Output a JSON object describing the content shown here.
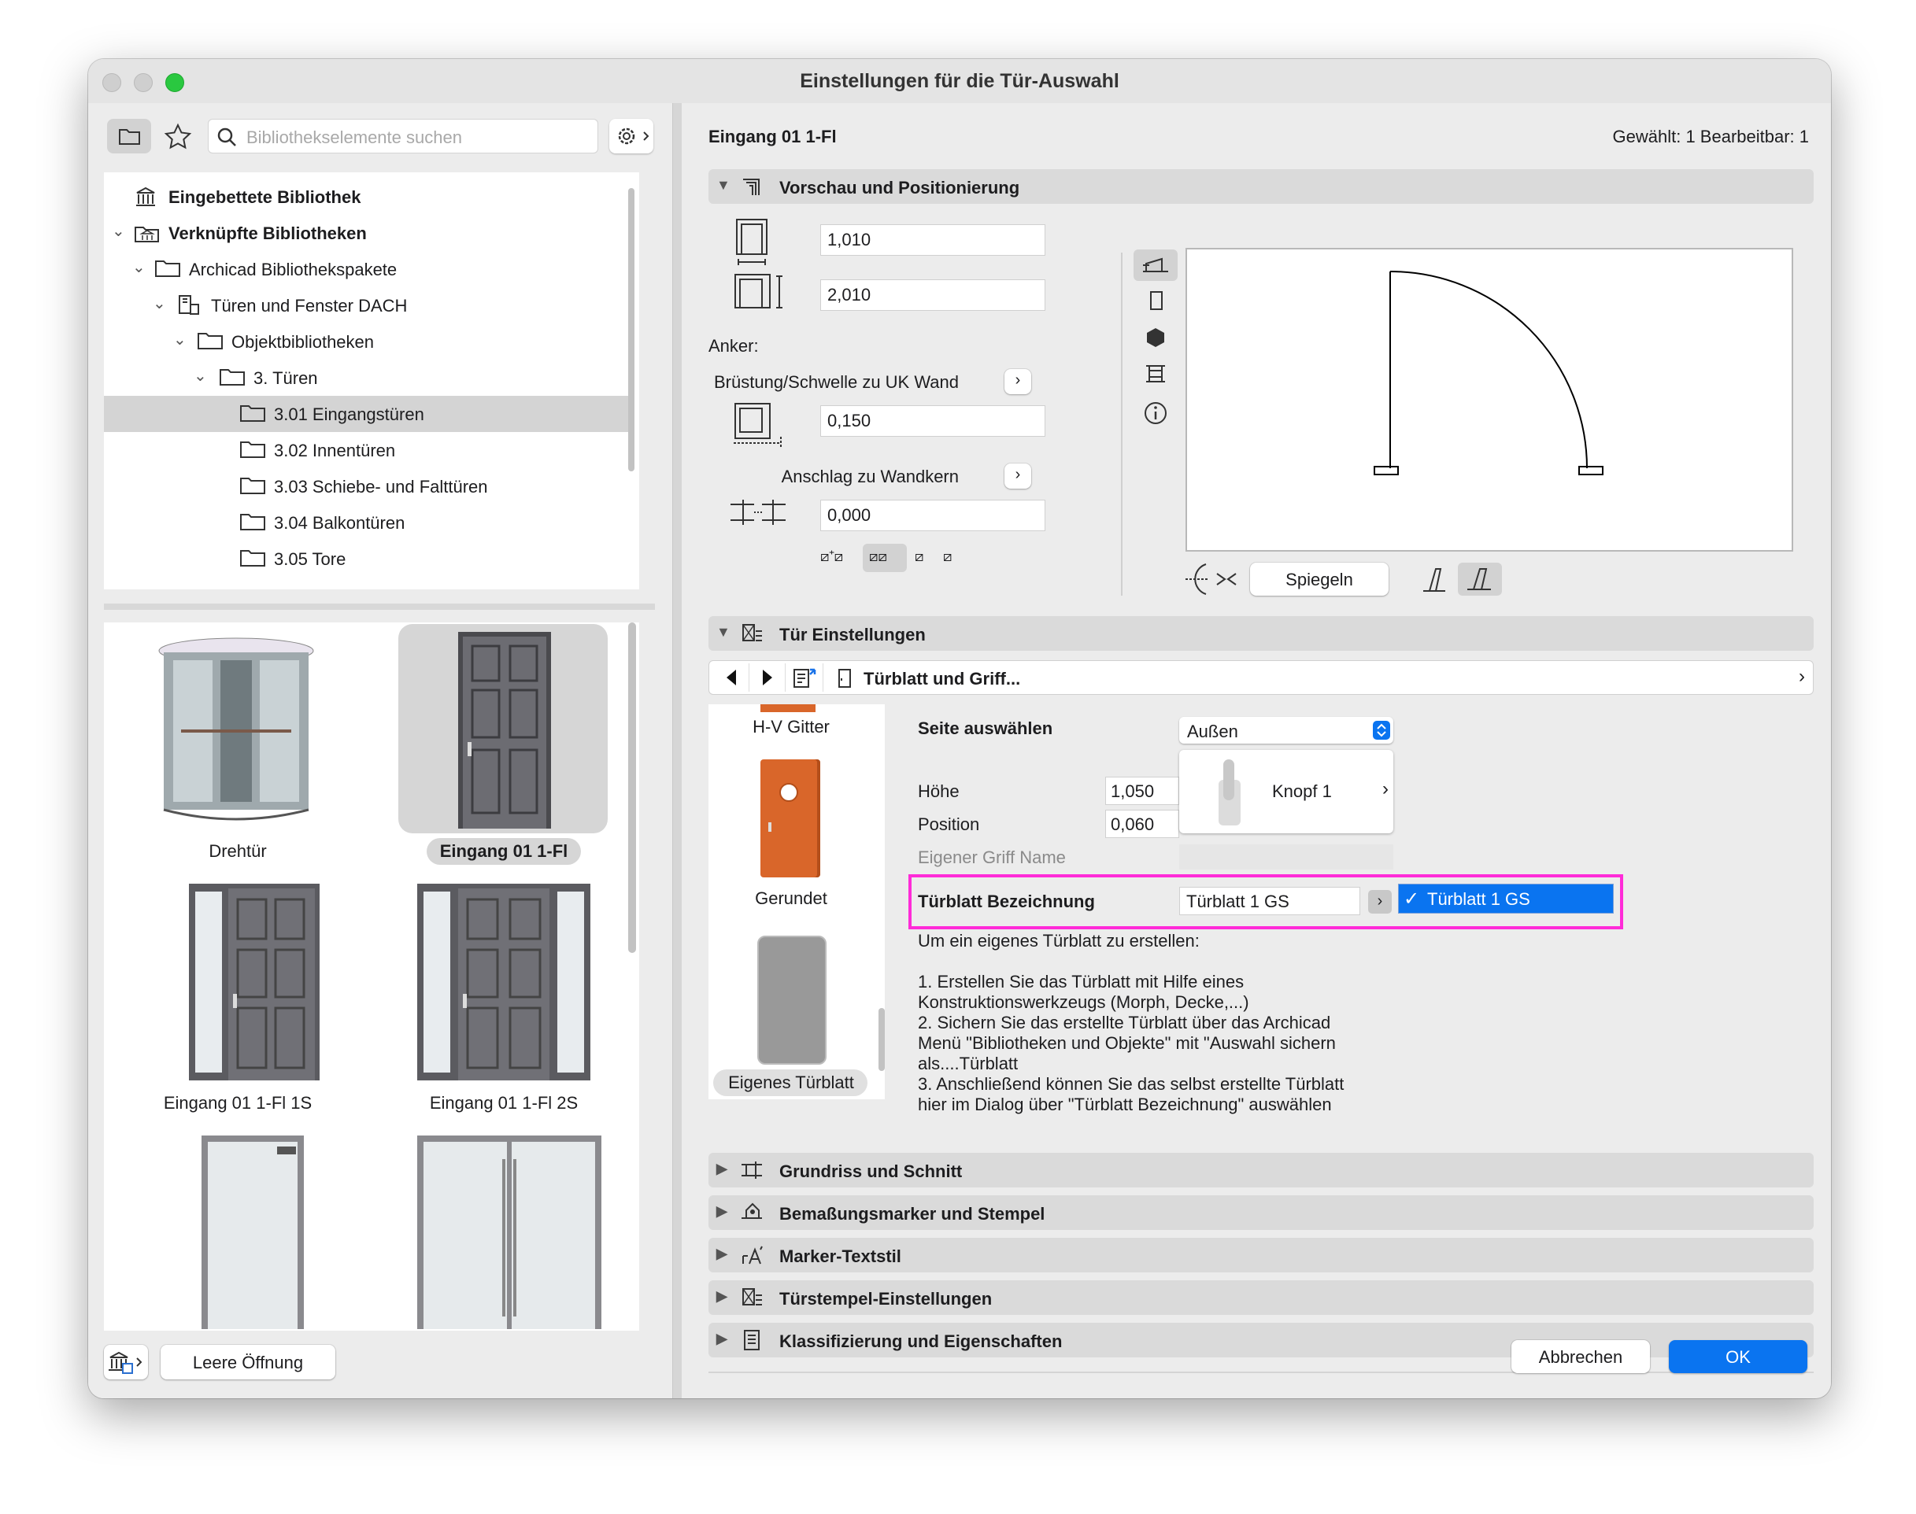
{
  "window": {
    "title": "Einstellungen für die Tür-Auswahl"
  },
  "library": {
    "search_placeholder": "Bibliothekselemente suchen",
    "tree": [
      {
        "label": "Eingebettete Bibliothek",
        "bold": true
      },
      {
        "label": "Verknüpfte Bibliotheken",
        "bold": true
      },
      {
        "label": "Archicad Bibliothekspakete"
      },
      {
        "label": "Türen und Fenster DACH"
      },
      {
        "label": "Objektbibliotheken"
      },
      {
        "label": "3. Türen"
      },
      {
        "label": "3.01 Eingangstüren",
        "selected": true
      },
      {
        "label": "3.02 Innentüren"
      },
      {
        "label": "3.03 Schiebe- und Falttüren"
      },
      {
        "label": "3.04 Balkontüren"
      },
      {
        "label": "3.05 Tore"
      }
    ],
    "tiles": [
      {
        "label": "Drehtür"
      },
      {
        "label": "Eingang 01 1-Fl",
        "selected": true
      },
      {
        "label": "Eingang 01 1-Fl 1S"
      },
      {
        "label": "Eingang 01 1-Fl 2S"
      },
      {
        "label": ""
      },
      {
        "label": ""
      }
    ],
    "empty_opening_label": "Leere Öffnung"
  },
  "header": {
    "element_name": "Eingang 01 1-Fl",
    "selection_info": "Gewählt: 1 Bearbeitbar: 1"
  },
  "preview": {
    "section_title": "Vorschau und Positionierung",
    "width_value": "1,010",
    "height_value": "2,010",
    "anchor_label": "Anker:",
    "sill_label": "Brüstung/Schwelle zu UK Wand",
    "sill_value": "0,150",
    "reveal_label": "Anschlag zu Wandkern",
    "reveal_value": "0,000",
    "mirror_label": "Spiegeln"
  },
  "door_settings": {
    "section_title": "Tür Einstellungen",
    "page_title": "Türblatt und Griff...",
    "thumbs": [
      {
        "label": "H-V Gitter"
      },
      {
        "label": "Gerundet"
      },
      {
        "label": "Eigenes Türblatt"
      }
    ],
    "side_label": "Seite auswählen",
    "side_value": "Außen",
    "height_label": "Höhe",
    "height_value": "1,050",
    "position_label": "Position",
    "position_value": "0,060",
    "handle_name": "Knopf 1",
    "custom_handle_label": "Eigener Griff Name",
    "leaf_label": "Türblatt Bezeichnung",
    "leaf_value": "Türblatt 1 GS",
    "leaf_popup_item": "Türblatt 1 GS",
    "help_lines": [
      "Um ein eigenes Türblatt zu erstellen:",
      "",
      "1. Erstellen Sie das Türblatt mit Hilfe eines",
      "Konstruktionswerkzeugs (Morph, Decke,...)",
      "2. Sichern Sie das erstellte Türblatt über das Archicad",
      "Menü \"Bibliotheken und Objekte\" mit \"Auswahl sichern",
      "als....Türblatt",
      "3. Anschließend können Sie das selbst erstellte Türblatt",
      "hier im Dialog über \"Türblatt Bezeichnung\" auswählen"
    ]
  },
  "sections": [
    {
      "label": "Grundriss und Schnitt"
    },
    {
      "label": "Bemaßungsmarker und Stempel"
    },
    {
      "label": "Marker-Textstil"
    },
    {
      "label": "Türstempel-Einstellungen"
    },
    {
      "label": "Klassifizierung und Eigenschaften"
    }
  ],
  "footer": {
    "cancel_label": "Abbrechen",
    "ok_label": "OK"
  },
  "colors": {
    "accent": "#0a74f0",
    "selection_row": "#d4d4d4",
    "highlight_annotation": "#ff2bd8",
    "traffic_close": "#c9c9c9",
    "traffic_min": "#c9c9c9",
    "traffic_zoom": "#2ac840"
  }
}
